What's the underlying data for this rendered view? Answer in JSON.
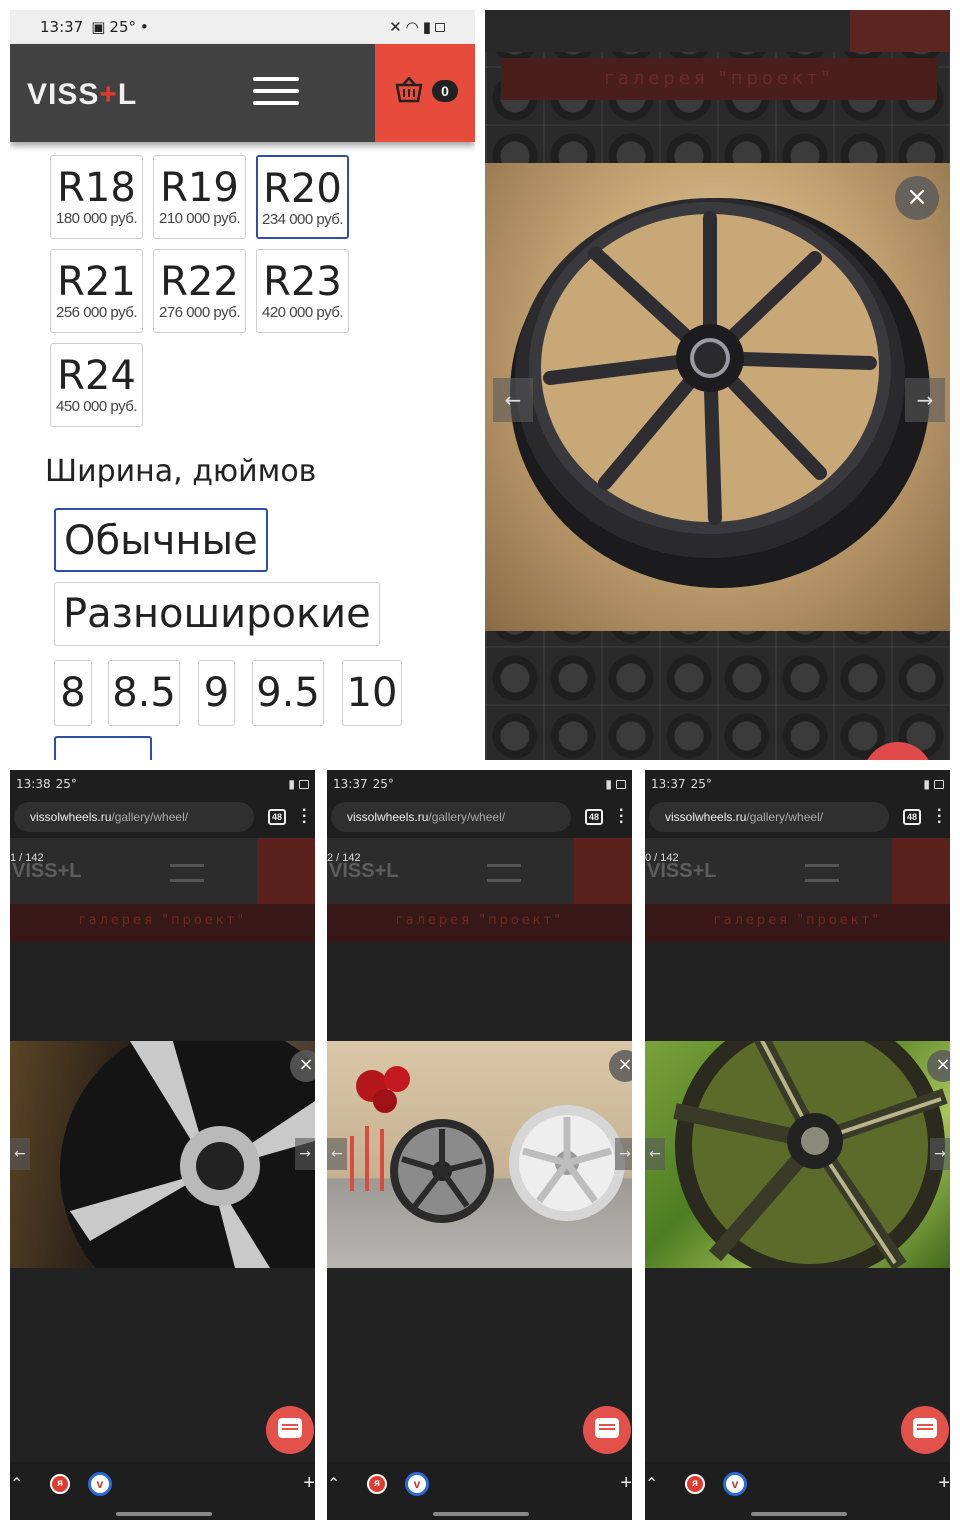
{
  "panel_main": {
    "status_time": "13:37",
    "status_temp": "25°",
    "logo": {
      "left": "VISS",
      "plus": "+",
      "right": "L"
    },
    "cart_count": "0",
    "sizes": [
      {
        "label": "R18",
        "price": "180 000 руб."
      },
      {
        "label": "R19",
        "price": "210 000 руб."
      },
      {
        "label": "R20",
        "price": "234 000 руб.",
        "selected": true
      },
      {
        "label": "R21",
        "price": "256 000 руб."
      },
      {
        "label": "R22",
        "price": "276 000 руб."
      },
      {
        "label": "R23",
        "price": "420 000 руб."
      },
      {
        "label": "R24",
        "price": "450 000 руб."
      }
    ],
    "width_title": "Ширина, дюймов",
    "width_types": [
      "Обычные",
      "Разноширокие"
    ],
    "width_values": [
      "8",
      "8.5",
      "9",
      "9.5",
      "10"
    ]
  },
  "gallery": {
    "title": "галерея \"проект\"",
    "close": "×",
    "prev": "←",
    "next": "→"
  },
  "phones": [
    {
      "time": "13:38",
      "temp": "25°",
      "url_host": "vissolwheels.ru",
      "url_path": "/gallery/wheel/",
      "tabs": "48",
      "counter": "1 / 142"
    },
    {
      "time": "13:37",
      "temp": "25°",
      "url_host": "vissolwheels.ru",
      "url_path": "/gallery/wheel/",
      "tabs": "48",
      "counter": "2 / 142"
    },
    {
      "time": "13:37",
      "temp": "25°",
      "url_host": "vissolwheels.ru",
      "url_path": "/gallery/wheel/",
      "tabs": "48",
      "counter": "0 / 142"
    }
  ],
  "colors": {
    "accent": "#e74b3c",
    "selected_border": "#2d4fa8",
    "header": "#414141"
  }
}
